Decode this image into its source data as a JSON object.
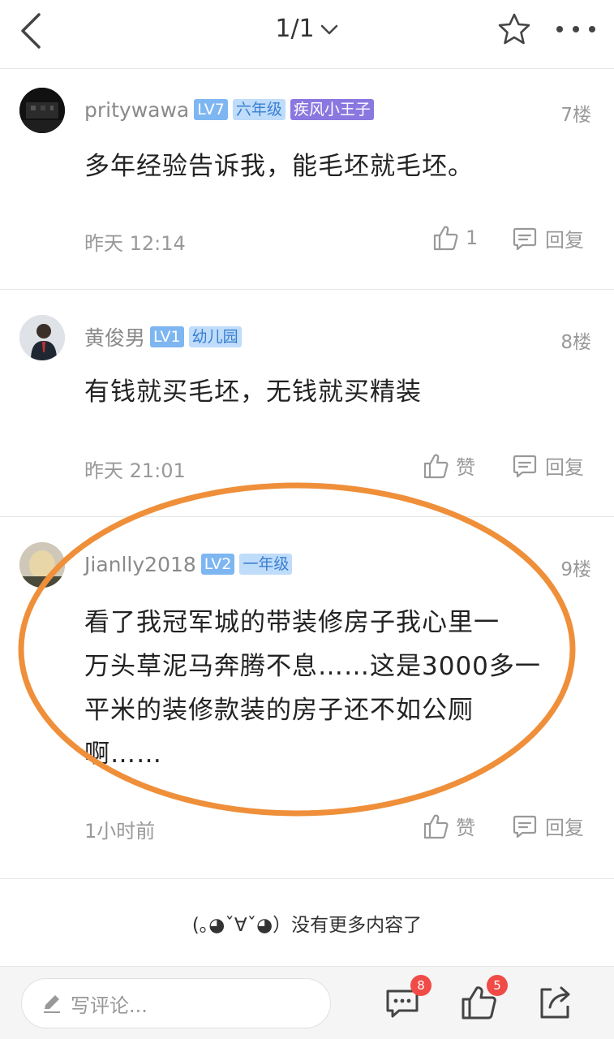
{
  "header": {
    "page_indicator": "1/1",
    "icons": [
      "back-arrow-icon",
      "chevron-down-icon",
      "star-icon",
      "more-dots-icon"
    ]
  },
  "comments": [
    {
      "username": "pritywawa",
      "level": "LV7",
      "grade": "六年级",
      "title": "疾风小王子",
      "floor": "7楼",
      "content": "多年经验告诉我，能毛坯就毛坯。",
      "time": "昨天 12:14",
      "like_label": "1",
      "reply_label": "回复"
    },
    {
      "username": "黄俊男",
      "level": "LV1",
      "grade": "幼儿园",
      "floor": "8楼",
      "content": "有钱就买毛坯，无钱就买精装",
      "time": "昨天 21:01",
      "like_label": "赞",
      "reply_label": "回复"
    },
    {
      "username": "Jianlly2018",
      "level": "LV2",
      "grade": "一年级",
      "floor": "9楼",
      "content_lines": [
        "看了我冠军城的带装修房子我心里一",
        "万头草泥马奔腾不息……这是3000多一",
        "平米的装修款装的房子还不如公厕",
        "啊……"
      ],
      "time": "1小时前",
      "like_label": "赞",
      "reply_label": "回复"
    }
  ],
  "no_more_text": "(｡◕ˇ∀ˇ◕）没有更多内容了",
  "bottom": {
    "input_placeholder": "写评论...",
    "comment_count": "8",
    "like_count": "5"
  },
  "colors": {
    "highlight_ellipse": "#ef8f3a",
    "badge_red": "#f04b47"
  }
}
